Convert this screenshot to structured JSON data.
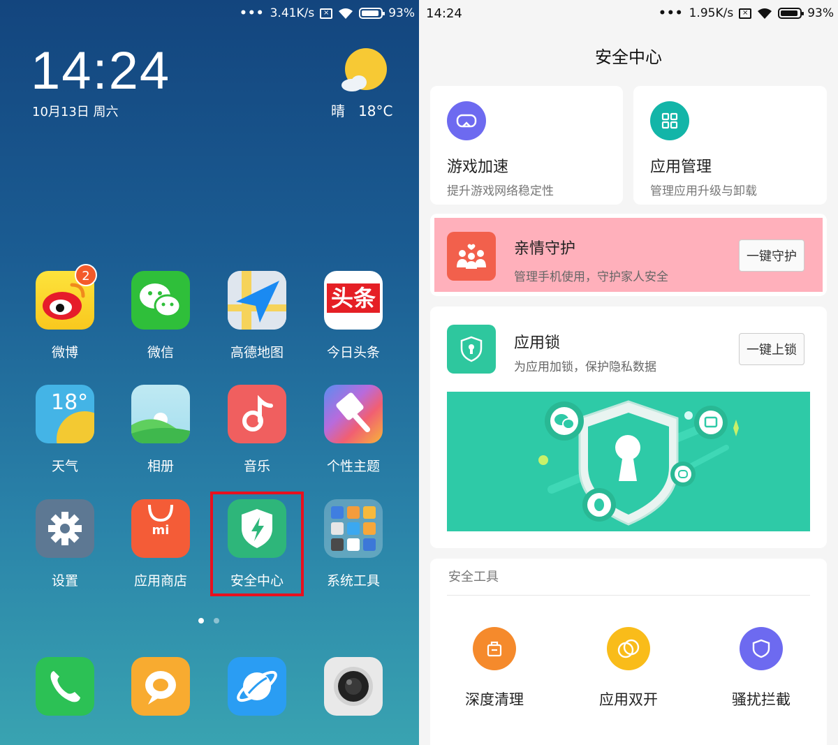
{
  "home": {
    "status": {
      "speed": "3.41K/s",
      "battery": "93%"
    },
    "clock": "14:24",
    "date": "10月13日 周六",
    "weather": {
      "condition": "晴",
      "temp": "18°C"
    },
    "apps": [
      {
        "label": "微博",
        "badge": "2"
      },
      {
        "label": "微信"
      },
      {
        "label": "高德地图"
      },
      {
        "label": "今日头条",
        "icon_text": "头条"
      },
      {
        "label": "天气",
        "icon_text": "18°"
      },
      {
        "label": "相册"
      },
      {
        "label": "音乐"
      },
      {
        "label": "个性主题"
      },
      {
        "label": "设置"
      },
      {
        "label": "应用商店",
        "icon_text": "mi"
      },
      {
        "label": "安全中心"
      },
      {
        "label": "系统工具"
      }
    ],
    "dock": [
      "phone-icon",
      "messages-icon",
      "browser-icon",
      "camera-icon"
    ]
  },
  "security": {
    "status": {
      "time": "14:24",
      "speed": "1.95K/s",
      "battery": "93%"
    },
    "title": "安全中心",
    "game": {
      "title": "游戏加速",
      "desc": "提升游戏网络稳定性"
    },
    "appmgr": {
      "title": "应用管理",
      "desc": "管理应用升级与卸载"
    },
    "family": {
      "title": "亲情守护",
      "desc": "管理手机使用，守护家人安全",
      "button": "一键守护"
    },
    "applock": {
      "title": "应用锁",
      "desc": "为应用加锁，保护隐私数据",
      "button": "一键上锁"
    },
    "tools": {
      "heading": "安全工具",
      "items": [
        {
          "label": "深度清理"
        },
        {
          "label": "应用双开"
        },
        {
          "label": "骚扰拦截"
        }
      ]
    },
    "colors": {
      "family_highlight": "#ffb0bb",
      "green": "#2ecaa7",
      "accent_purple": "#6d6af0"
    }
  }
}
